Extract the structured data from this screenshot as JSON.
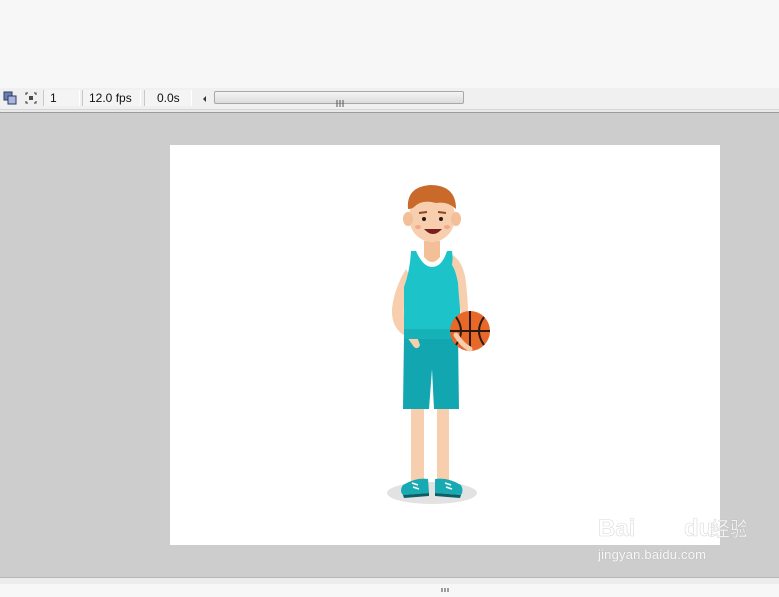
{
  "status_bar": {
    "frame_number": "1",
    "frame_rate": "12.0 fps",
    "elapsed_time": "0.0s"
  },
  "icons": {
    "center_frame": "center-frame-icon",
    "onion_skin": "onion-skin-icon",
    "scroll_left": "scroll-left-arrow-icon",
    "scroll_grip": "scroll-grip-icon"
  },
  "stage": {
    "illustration": "basketball-player-illustration",
    "colors": {
      "stage_bg": "#cdcdcd",
      "canvas_bg": "#ffffff",
      "jersey": "#1cc4c9",
      "shorts": "#12a7b0",
      "skin": "#f7cfae",
      "hair": "#c96a2b",
      "ball": "#e8682a"
    }
  },
  "watermark": {
    "brand": "Baidu经验",
    "url": "jingyan.baidu.com"
  }
}
